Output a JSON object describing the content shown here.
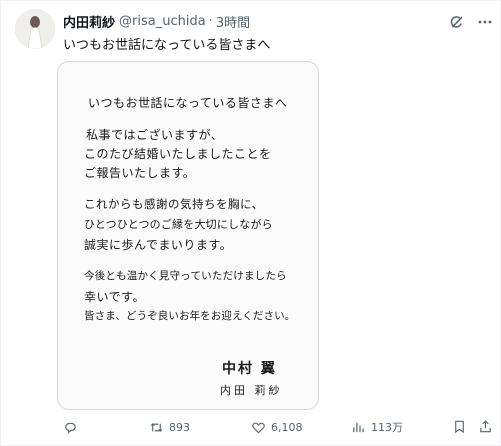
{
  "author": {
    "display_name": "内田莉紗",
    "handle": "@risa_uchida",
    "separator": "·",
    "time": "3時間"
  },
  "post": {
    "text": "いつもお世話になっている皆さまへ"
  },
  "letter": {
    "lines": [
      "いつもお世話になっている皆さまへ",
      "私事ではございますが、",
      "このたび結婚いたしましたことを",
      "ご報告いたします。",
      "これからも感謝の気持ちを胸に、",
      "ひとつひとつのご縁を大切にしながら",
      "誠実に歩んでまいります。",
      "今後とも温かく見守っていただけましたら",
      "幸いです。",
      "皆さま、どうぞ良いお年をお迎えください。"
    ],
    "signature_1": "中村 翼",
    "signature_2": "内田 莉紗"
  },
  "actions": {
    "retweets": "893",
    "likes": "6,108",
    "views": "113万"
  },
  "icons": {
    "grok": "grok-icon",
    "more": "more-icon",
    "reply": "reply-icon",
    "retweet": "retweet-icon",
    "like": "heart-icon",
    "views": "views-icon",
    "bookmark": "bookmark-icon",
    "share": "share-icon"
  },
  "colors": {
    "text": "#0f1419",
    "muted": "#536471",
    "border": "#cfd9de"
  }
}
